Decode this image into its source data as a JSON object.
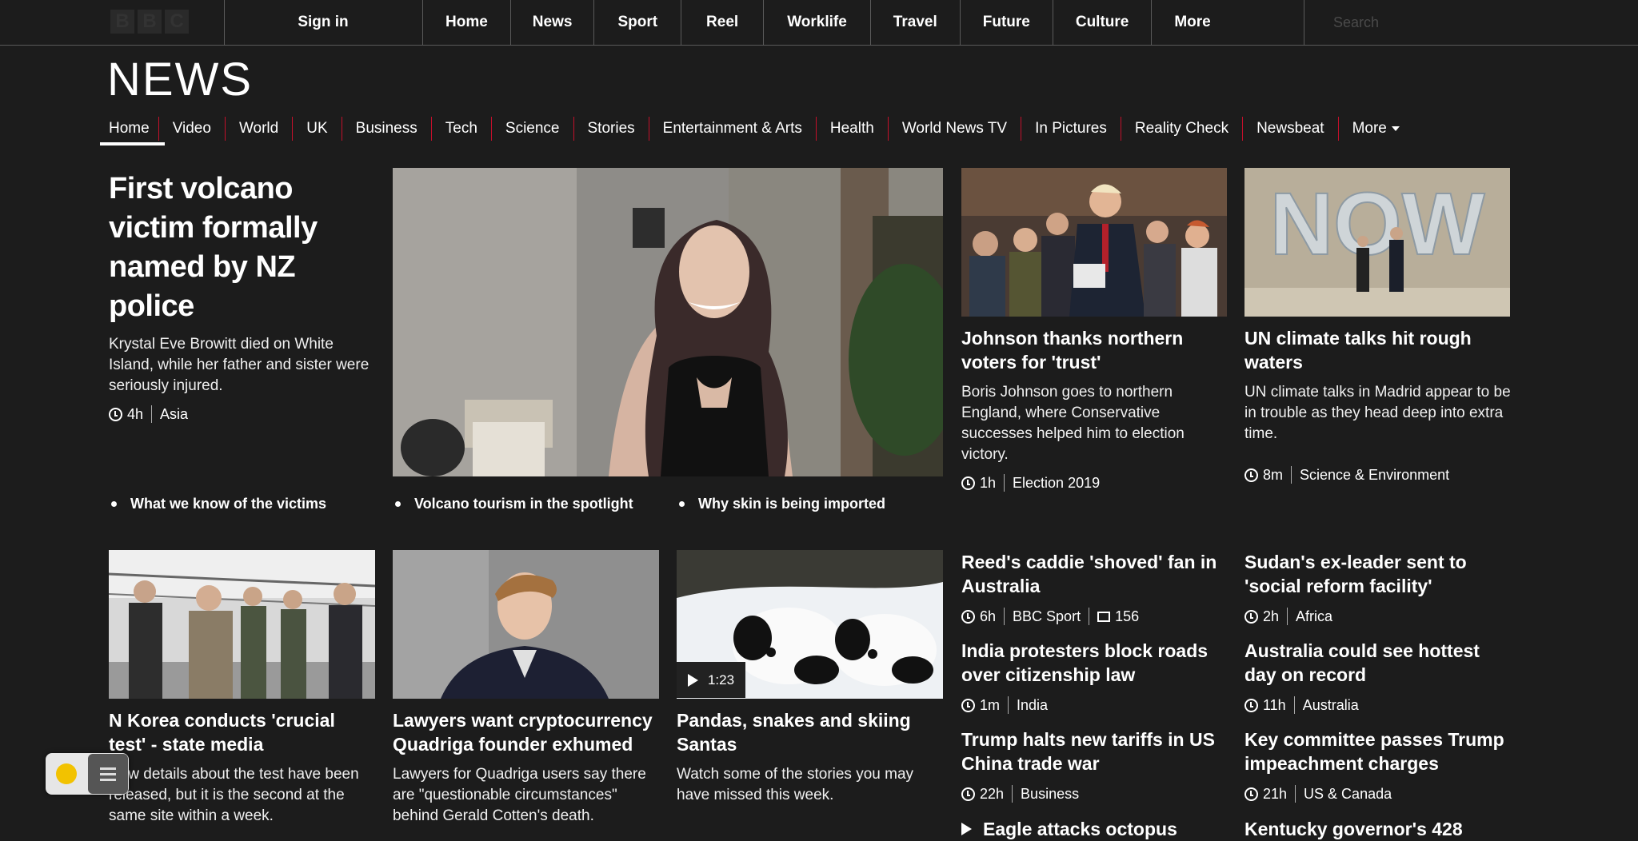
{
  "topbar": {
    "logo_letters": [
      "B",
      "B",
      "C"
    ],
    "signin": "Sign in",
    "nav": [
      "Home",
      "News",
      "Sport",
      "Reel",
      "Worklife",
      "Travel",
      "Future",
      "Culture",
      "More"
    ],
    "search_placeholder": "Search"
  },
  "header": {
    "logo": "NEWS",
    "subnav": [
      "Home",
      "Video",
      "World",
      "UK",
      "Business",
      "Tech",
      "Science",
      "Stories",
      "Entertainment & Arts",
      "Health",
      "World News TV",
      "In Pictures",
      "Reality Check",
      "Newsbeat",
      "More"
    ],
    "active": "Home"
  },
  "lead": {
    "title": "First volcano victim formally named by NZ police",
    "summary": "Krystal Eve Browitt died on White Island, while her father and sister were seriously injured.",
    "time": "4h",
    "section": "Asia",
    "related": [
      "What we know of the victims",
      "Volcano tourism in the spotlight",
      "Why skin is being imported"
    ]
  },
  "top_right": [
    {
      "title": "Johnson thanks northern voters for 'trust'",
      "summary": "Boris Johnson goes to northern England, where Conservative successes helped him to election victory.",
      "time": "1h",
      "section": "Election 2019"
    },
    {
      "title": "UN climate talks hit rough waters",
      "summary": "UN climate talks in Madrid appear to be in trouble as they head deep into extra time.",
      "time": "8m",
      "section": "Science & Environment",
      "image_text": "NOW"
    }
  ],
  "second_row": [
    {
      "title": "N Korea conducts 'crucial test' - state media",
      "summary": "New details about the test have been released, but it is the second at the same site within a week."
    },
    {
      "title": "Lawyers want cryptocurrency Quadriga founder exhumed",
      "summary": "Lawyers for Quadriga users say there are \"questionable circumstances\" behind Gerald Cotten's death."
    },
    {
      "title": "Pandas, snakes and skiing Santas",
      "summary": "Watch some of the stories you may have missed this week.",
      "video_duration": "1:23"
    }
  ],
  "list_left": [
    {
      "title": "Reed's caddie 'shoved' fan in Australia",
      "time": "6h",
      "section": "BBC Sport",
      "comments": "156"
    },
    {
      "title": "India protesters block roads over citizenship law",
      "time": "1m",
      "section": "India"
    },
    {
      "title": "Trump halts new tariffs in US China trade war",
      "time": "22h",
      "section": "Business"
    },
    {
      "title": "Eagle attacks octopus"
    }
  ],
  "list_right": [
    {
      "title": "Sudan's ex-leader sent to 'social reform facility'",
      "time": "2h",
      "section": "Africa"
    },
    {
      "title": "Australia could see hottest day on record",
      "time": "11h",
      "section": "Australia"
    },
    {
      "title": "Key committee passes Trump impeachment charges",
      "time": "21h",
      "section": "US & Canada"
    },
    {
      "title": "Kentucky governor's 428"
    }
  ],
  "colors": {
    "background": "#1c1c1c",
    "accent_separator": "#c4102b",
    "text": "#ffffff"
  }
}
